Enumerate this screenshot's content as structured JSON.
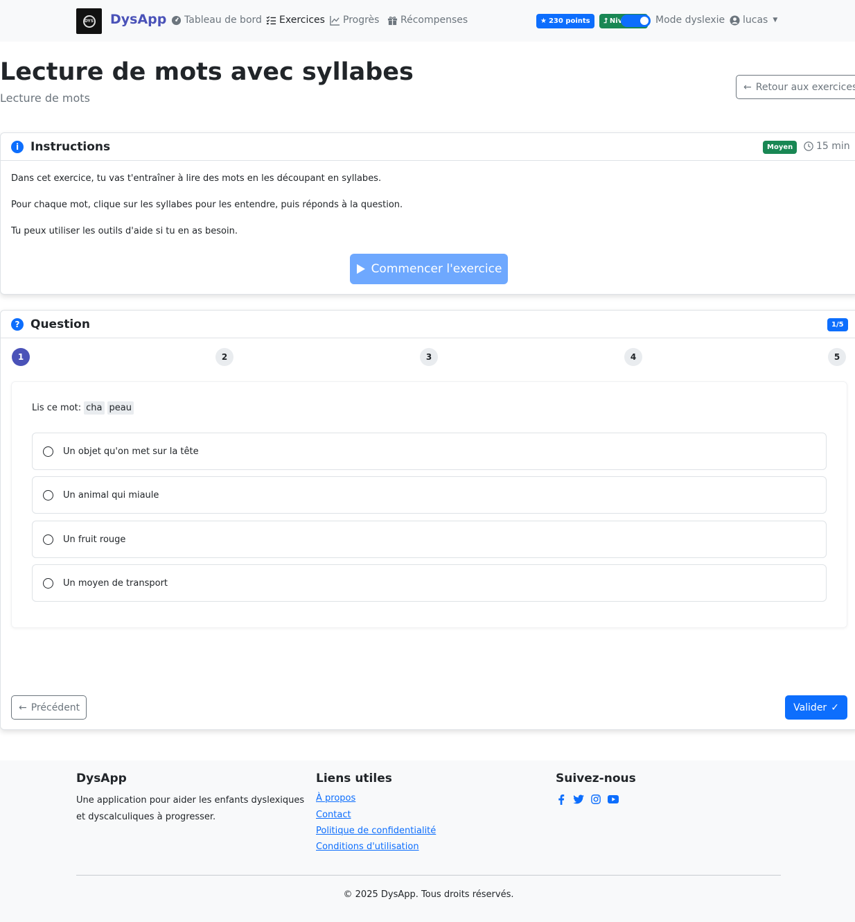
{
  "navbar": {
    "brand": "DysApp",
    "items": [
      {
        "label": "Tableau de bord",
        "icon": "dashboard-icon"
      },
      {
        "label": "Exercices",
        "icon": "list-check-icon"
      },
      {
        "label": "Progrès",
        "icon": "chart-line-icon"
      },
      {
        "label": "Récompenses",
        "icon": "gift-icon"
      }
    ],
    "points": "230 points",
    "level": "Nivea",
    "dyslexia_mode": "Mode dyslexie",
    "user": "lucas"
  },
  "header": {
    "title": "Lecture de mots avec syllabes",
    "subtitle": "Lecture de mots",
    "back_label": "Retour aux exercices"
  },
  "instructions": {
    "title": "Instructions",
    "difficulty": "Moyen",
    "duration": "15 min",
    "lines": [
      "Dans cet exercice, tu vas t'entraîner à lire des mots en les découpant en syllabes.",
      "Pour chaque mot, clique sur les syllabes pour les entendre, puis réponds à la question.",
      "Tu peux utiliser les outils d'aide si tu en as besoin."
    ],
    "start_label": "Commencer l'exercice"
  },
  "question": {
    "title": "Question",
    "progress": "1/5",
    "steps": [
      "1",
      "2",
      "3",
      "4",
      "5"
    ],
    "current_step": 1,
    "prompt_label": "Lis ce mot:",
    "syllables": [
      "cha",
      "peau"
    ],
    "options": [
      "Un objet qu'on met sur la tête",
      "Un animal qui miaule",
      "Un fruit rouge",
      "Un moyen de transport"
    ],
    "prev_label": "Précédent",
    "validate_label": "Valider"
  },
  "footer": {
    "about_title": "DysApp",
    "about_text": "Une application pour aider les enfants dyslexiques et dyscalculiques à progresser.",
    "links_title": "Liens utiles",
    "links": [
      "À propos",
      "Contact",
      "Politique de confidentialité",
      "Conditions d'utilisation"
    ],
    "follow_title": "Suivez-nous",
    "socials": [
      "facebook-icon",
      "twitter-icon",
      "instagram-icon",
      "youtube-icon"
    ],
    "copyright": "© 2025 DysApp. Tous droits réservés."
  },
  "colors": {
    "primary": "#0d6efd",
    "brand": "#4a52b8",
    "success": "#198754",
    "disabled_primary": "#6ea8fe"
  }
}
